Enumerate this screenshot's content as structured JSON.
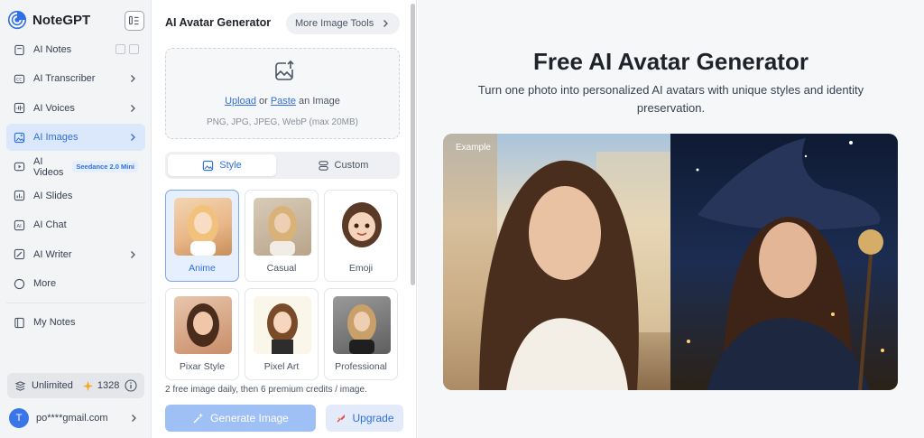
{
  "app": {
    "brand": "NoteGPT"
  },
  "sidebar": {
    "items": [
      {
        "label": "AI Notes"
      },
      {
        "label": "AI Transcriber"
      },
      {
        "label": "AI Voices"
      },
      {
        "label": "AI Images"
      },
      {
        "label": "AI Videos",
        "badge": "Seedance 2.0 Mini"
      },
      {
        "label": "AI Slides"
      },
      {
        "label": "AI Chat"
      },
      {
        "label": "AI Writer"
      },
      {
        "label": "More"
      },
      {
        "label": "My Notes"
      }
    ],
    "active_item": "AI Images",
    "credits": {
      "plan": "Unlimited",
      "count": "1328"
    },
    "account": {
      "avatar_letter": "T",
      "email": "po****gmail.com"
    }
  },
  "panel": {
    "title": "AI Avatar Generator",
    "more_tools": "More Image Tools",
    "upload": {
      "link_upload": "Upload",
      "or": "or",
      "link_paste": "Paste",
      "suffix": "an Image",
      "hint": "PNG, JPG, JPEG, WebP (max 20MB)"
    },
    "tabs": [
      {
        "label": "Style",
        "active": true
      },
      {
        "label": "Custom",
        "active": false
      }
    ],
    "styles": [
      {
        "label": "Anime",
        "selected": true
      },
      {
        "label": "Casual",
        "selected": false
      },
      {
        "label": "Emoji",
        "selected": false
      },
      {
        "label": "Pixar Style",
        "selected": false
      },
      {
        "label": "Pixel Art",
        "selected": false
      },
      {
        "label": "Professional",
        "selected": false
      }
    ],
    "free_note": "2 free image daily, then 6 premium credits / image.",
    "generate_button": "Generate Image",
    "upgrade_button": "Upgrade"
  },
  "main": {
    "title": "Free AI Avatar Generator",
    "subtitle": "Turn one photo into personalized AI avatars with unique styles and identity preservation.",
    "example_tag": "Example"
  },
  "colors": {
    "accent": "#2f6fe4",
    "active_bg": "#dbe8fb",
    "generate_disabled": "#9fc0f4"
  }
}
